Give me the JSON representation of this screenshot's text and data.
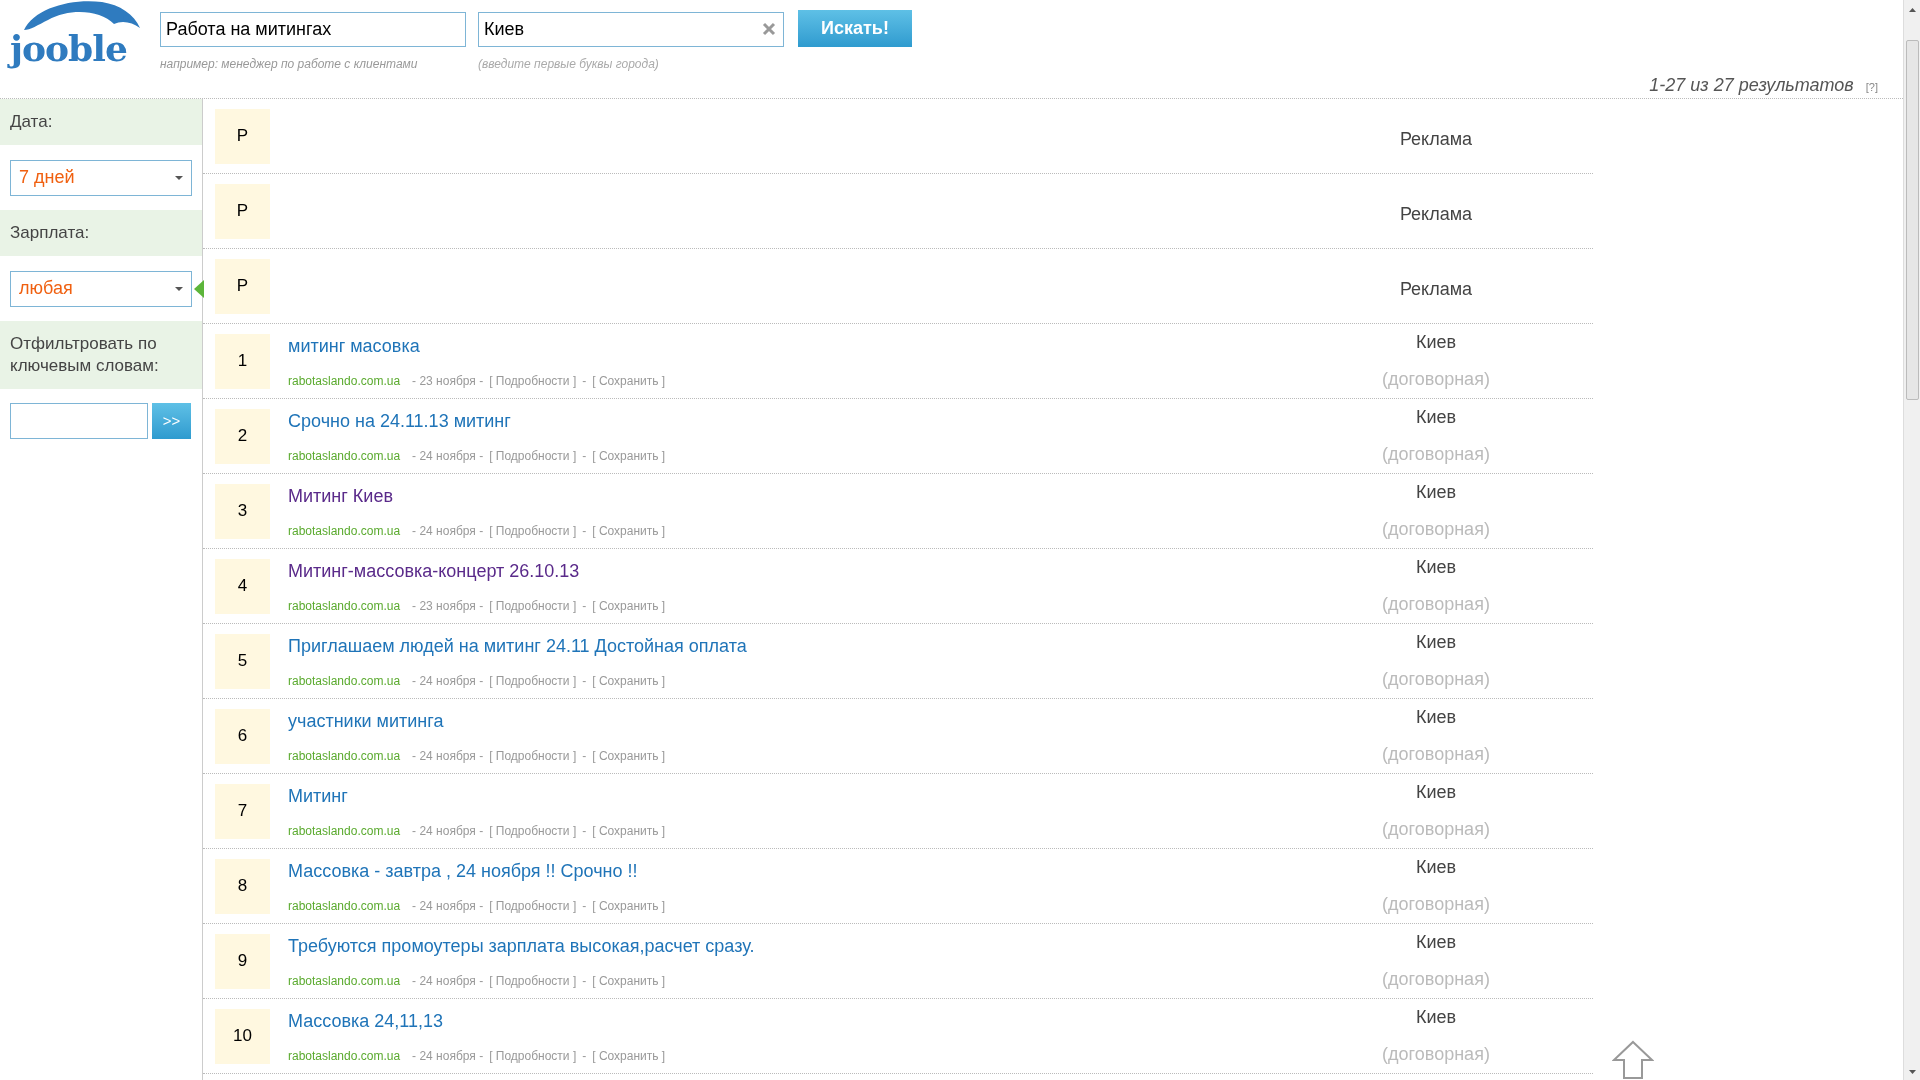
{
  "logo": "jooble",
  "search": {
    "query": {
      "value": "Работа на митингах",
      "hint": "например: менеджер по работе с клиентами"
    },
    "city": {
      "value": "Киев",
      "hint": "(введите первые буквы города)"
    },
    "button": "Искать!"
  },
  "results_summary": {
    "text": "1-27 из 27 результатов",
    "help": "[?]"
  },
  "sidebar": {
    "sections": [
      {
        "kind": "select",
        "label": "Дата:",
        "value": "7 дней",
        "pointer": false
      },
      {
        "kind": "select",
        "label": "Зарплата:",
        "value": "любая",
        "pointer": true
      },
      {
        "kind": "keyword",
        "label": "Отфильтровать по ключевым словам:",
        "button": ">>"
      }
    ]
  },
  "results": [
    {
      "kind": "ad",
      "marker": "Р",
      "label": "Реклама"
    },
    {
      "kind": "ad",
      "marker": "Р",
      "label": "Реклама"
    },
    {
      "kind": "ad",
      "marker": "Р",
      "label": "Реклама"
    },
    {
      "kind": "job",
      "marker": "1",
      "title": "митинг масовка",
      "visited": false,
      "source": "rabotaslando.com.ua",
      "date": "- 23 ноября -",
      "details": "[ Подробности ]",
      "separator": "-",
      "save": "[ Сохранить ]",
      "city": "Киев",
      "salary": "(договорная)"
    },
    {
      "kind": "job",
      "marker": "2",
      "title": "Срочно на 24.11.13 митинг",
      "visited": false,
      "source": "rabotaslando.com.ua",
      "date": "- 24 ноября -",
      "details": "[ Подробности ]",
      "separator": "-",
      "save": "[ Сохранить ]",
      "city": "Киев",
      "salary": "(договорная)"
    },
    {
      "kind": "job",
      "marker": "3",
      "title": "Митинг Киев",
      "visited": true,
      "source": "rabotaslando.com.ua",
      "date": "- 24 ноября -",
      "details": "[ Подробности ]",
      "separator": "-",
      "save": "[ Сохранить ]",
      "city": "Киев",
      "salary": "(договорная)"
    },
    {
      "kind": "job",
      "marker": "4",
      "title": "Митинг-массовка-концерт 26.10.13",
      "visited": true,
      "source": "rabotaslando.com.ua",
      "date": "- 23 ноября -",
      "details": "[ Подробности ]",
      "separator": "-",
      "save": "[ Сохранить ]",
      "city": "Киев",
      "salary": "(договорная)"
    },
    {
      "kind": "job",
      "marker": "5",
      "title": "Приглашаем людей на митинг 24.11 Достойная оплата",
      "visited": false,
      "source": "rabotaslando.com.ua",
      "date": "- 24 ноября -",
      "details": "[ Подробности ]",
      "separator": "-",
      "save": "[ Сохранить ]",
      "city": "Киев",
      "salary": "(договорная)"
    },
    {
      "kind": "job",
      "marker": "6",
      "title": "участники митинга",
      "visited": false,
      "source": "rabotaslando.com.ua",
      "date": "- 24 ноября -",
      "details": "[ Подробности ]",
      "separator": "-",
      "save": "[ Сохранить ]",
      "city": "Киев",
      "salary": "(договорная)"
    },
    {
      "kind": "job",
      "marker": "7",
      "title": "Митинг",
      "visited": false,
      "source": "rabotaslando.com.ua",
      "date": "- 24 ноября -",
      "details": "[ Подробности ]",
      "separator": "-",
      "save": "[ Сохранить ]",
      "city": "Киев",
      "salary": "(договорная)"
    },
    {
      "kind": "job",
      "marker": "8",
      "title": "Массовка - завтра , 24 ноября !! Срочно !!",
      "visited": false,
      "source": "rabotaslando.com.ua",
      "date": "- 24 ноября -",
      "details": "[ Подробности ]",
      "separator": "-",
      "save": "[ Сохранить ]",
      "city": "Киев",
      "salary": "(договорная)"
    },
    {
      "kind": "job",
      "marker": "9",
      "title": "Требуются промоутеры зарплата высокая,расчет сразу.",
      "visited": false,
      "source": "rabotaslando.com.ua",
      "date": "- 24 ноября -",
      "details": "[ Подробности ]",
      "separator": "-",
      "save": "[ Сохранить ]",
      "city": "Киев",
      "salary": "(договорная)"
    },
    {
      "kind": "job",
      "marker": "10",
      "title": "Массовка 24,11,13",
      "visited": false,
      "source": "rabotaslando.com.ua",
      "date": "- 24 ноября -",
      "details": "[ Подробности ]",
      "separator": "-",
      "save": "[ Сохранить ]",
      "city": "Киев",
      "salary": "(договорная)"
    }
  ]
}
